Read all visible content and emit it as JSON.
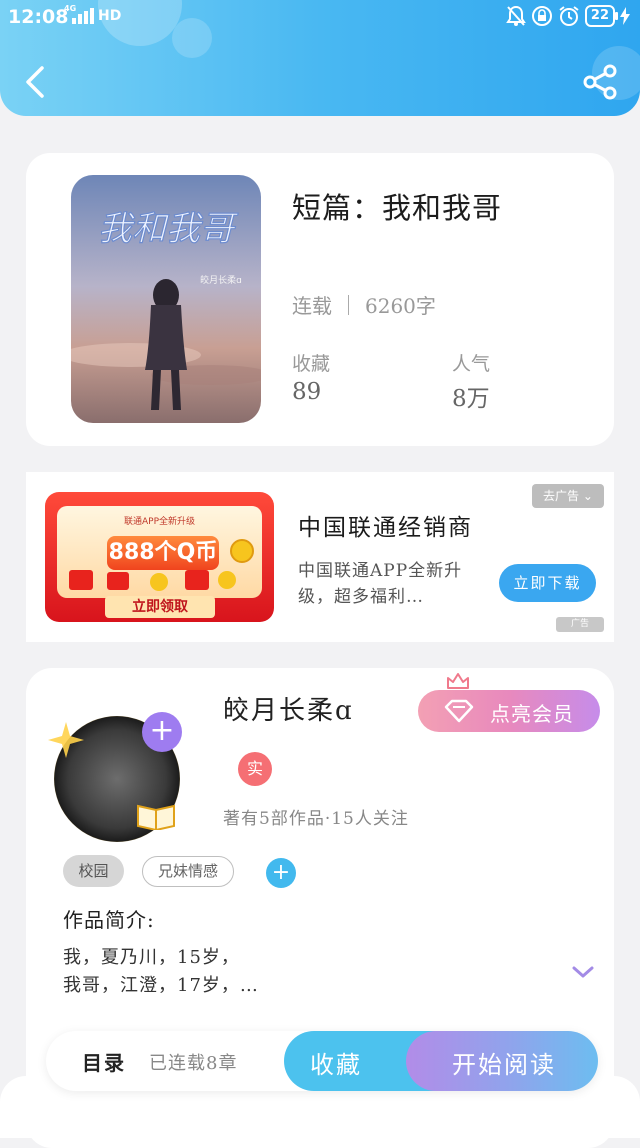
{
  "status_bar": {
    "time": "12:08",
    "network": "4G",
    "hd": "HD",
    "battery": "22"
  },
  "book": {
    "title": "短篇：我和我哥",
    "status": "连载",
    "word_count": "6260字",
    "favorites_label": "收藏",
    "favorites_value": "89",
    "popularity_label": "人气",
    "popularity_value": "8万",
    "cover_title": "我和我哥",
    "cover_author": "皎月长柔ɑ"
  },
  "ad": {
    "image_subtitle": "联通APP全新升级",
    "image_headline": "888个Q币",
    "image_cta": "立即领取",
    "title": "中国联通经销商",
    "description": "中国联通APP全新升级，超多福利…",
    "download_label": "立即下载",
    "remove_label": "去广告",
    "ad_mark": "广告"
  },
  "author": {
    "name": "皎月长柔ɑ",
    "vip_label": "点亮会员",
    "verified_label": "实",
    "meta": "著有5部作品·15人关注",
    "tags": [
      "校园",
      "兄妹情感"
    ],
    "intro_label": "作品简介:",
    "intro_line1": "我，夏乃川，15岁，",
    "intro_line2": "我哥，江澄，17岁，…"
  },
  "bottom_bar": {
    "toc_label": "目录",
    "chapters_label": "已连载8章",
    "favorite_label": "收藏",
    "read_label": "开始阅读"
  },
  "colors": {
    "header_accent": "#49b8f2",
    "favorite_button": "#4cc2ee",
    "read_button": "#b28ce8",
    "verified": "#f56f74"
  }
}
